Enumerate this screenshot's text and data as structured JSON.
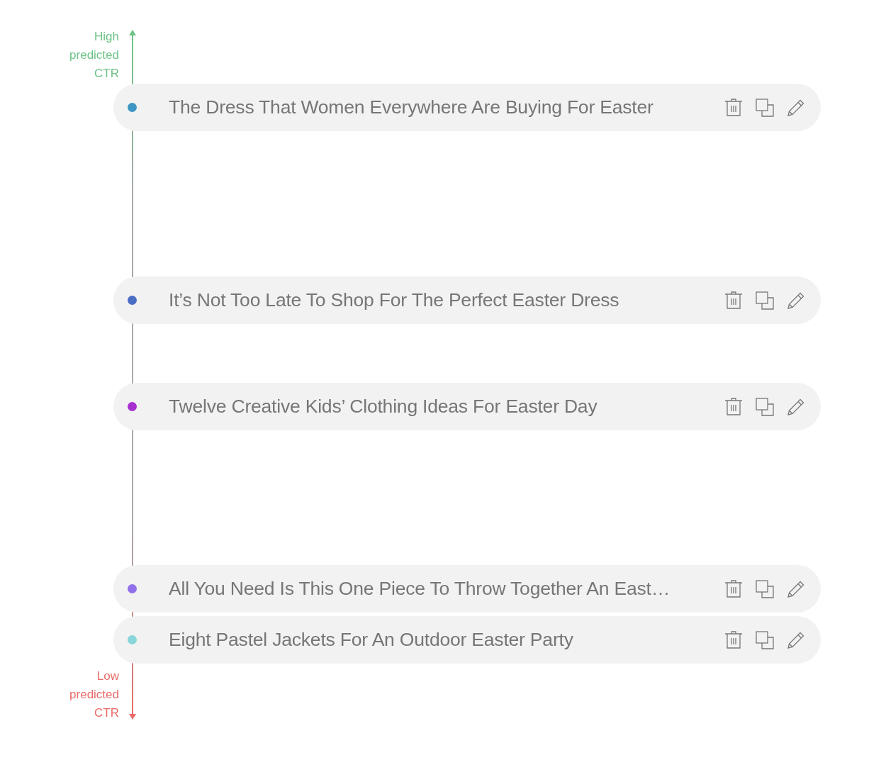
{
  "axis": {
    "top_label": [
      "High",
      "predicted",
      "CTR"
    ],
    "bottom_label": [
      "Low",
      "predicted",
      "CTR"
    ]
  },
  "headlines": [
    {
      "title": "The Dress That Women Everywhere Are Buying For Easter",
      "color": "#3d95c4"
    },
    {
      "title": "It’s Not Too Late To Shop For The Perfect Easter Dress",
      "color": "#4a6ec4"
    },
    {
      "title": "Twelve Creative Kids’ Clothing Ideas For Easter Day",
      "color": "#a630d0"
    },
    {
      "title": "All You Need Is This One Piece To Throw Together An East…",
      "color": "#9270ea"
    },
    {
      "title": "Eight Pastel Jackets For An Outdoor Easter Party",
      "color": "#88d6da"
    }
  ]
}
